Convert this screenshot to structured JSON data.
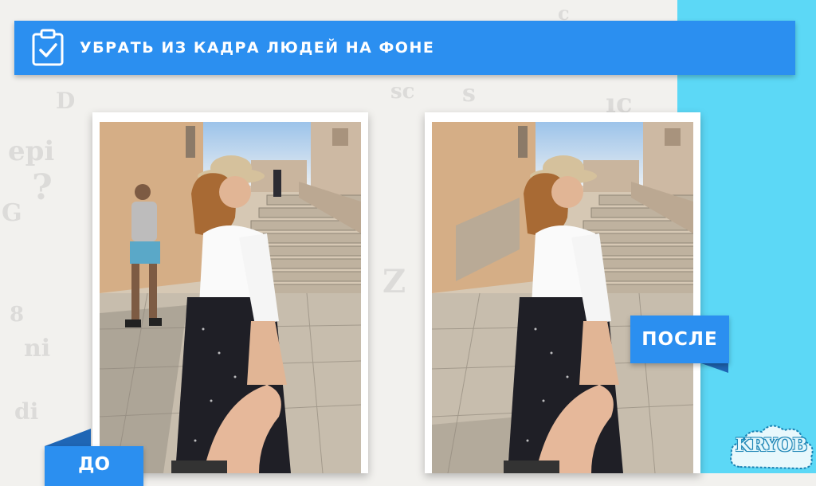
{
  "header": {
    "title": "УБРАТЬ ИЗ КАДРА ЛЮДЕЙ НА ФОНЕ",
    "icon": "clipboard-check-icon"
  },
  "photos": {
    "before": {
      "label": "ДО",
      "description_icon": "photo-with-background-people"
    },
    "after": {
      "label": "ПОСЛЕ",
      "description_icon": "photo-without-background-people"
    }
  },
  "logo": {
    "text": "KRYOB"
  },
  "colors": {
    "accent_blue": "#2b8ff0",
    "strip_cyan": "#5cd8f6",
    "background": "#f2f1ee"
  }
}
